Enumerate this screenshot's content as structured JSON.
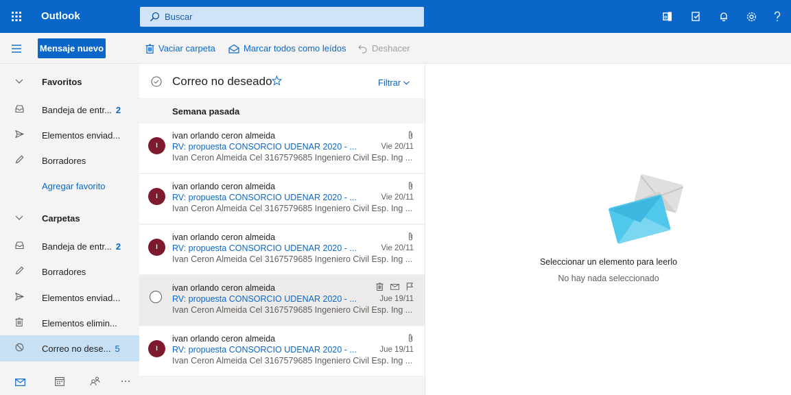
{
  "app": {
    "name": "Outlook",
    "search_placeholder": "Buscar"
  },
  "colors": {
    "brand": "#0a67c9",
    "avatar": "#7d1a2e",
    "selected_nav": "#c7e0f4"
  },
  "toolbar": {
    "new_message": "Mensaje nuevo",
    "empty_folder": "Vaciar carpeta",
    "mark_all_read": "Marcar todos como leídos",
    "undo": "Deshacer"
  },
  "nav": {
    "favorites_header": "Favoritos",
    "favorites": [
      {
        "label": "Bandeja de entr...",
        "count": "2",
        "icon": "inbox-icon"
      },
      {
        "label": "Elementos enviad...",
        "count": "",
        "icon": "send-icon"
      },
      {
        "label": "Borradores",
        "count": "",
        "icon": "pencil-icon"
      }
    ],
    "add_favorite": "Agregar favorito",
    "folders_header": "Carpetas",
    "folders": [
      {
        "label": "Bandeja de entr...",
        "count": "2",
        "icon": "inbox-icon"
      },
      {
        "label": "Borradores",
        "count": "",
        "icon": "pencil-icon"
      },
      {
        "label": "Elementos enviad...",
        "count": "",
        "icon": "send-icon"
      },
      {
        "label": "Elementos elimin...",
        "count": "",
        "icon": "trash-icon"
      },
      {
        "label": "Correo no dese...",
        "count": "5",
        "icon": "block-icon",
        "selected": true
      }
    ]
  },
  "list": {
    "title": "Correo no deseado",
    "filter": "Filtrar",
    "group": "Semana pasada",
    "messages": [
      {
        "initial": "I",
        "from": "ivan orlando ceron almeida",
        "subject": "RV: propuesta CONSORCIO UDENAR 2020 - ...",
        "preview": "Ivan Ceron Almeida Cel 3167579685 Ingeniero Civil Esp. Ing ...",
        "date": "Vie 20/11"
      },
      {
        "initial": "I",
        "from": "ivan orlando ceron almeida",
        "subject": "RV: propuesta CONSORCIO UDENAR 2020 - ...",
        "preview": "Ivan Ceron Almeida Cel 3167579685 Ingeniero Civil Esp. Ing ...",
        "date": "Vie 20/11"
      },
      {
        "initial": "I",
        "from": "ivan orlando ceron almeida",
        "subject": "RV: propuesta CONSORCIO UDENAR 2020 - ...",
        "preview": "Ivan Ceron Almeida Cel 3167579685 Ingeniero Civil Esp. Ing ...",
        "date": "Vie 20/11"
      },
      {
        "initial": "",
        "from": "ivan orlando ceron almeida",
        "subject": "RV: propuesta CONSORCIO UDENAR 2020 - ...",
        "preview": "Ivan Ceron Almeida Cel 3167579685 Ingeniero Civil Esp. Ing ...",
        "date": "Jue 19/11",
        "hovered": true
      },
      {
        "initial": "I",
        "from": "ivan orlando ceron almeida",
        "subject": "RV: propuesta CONSORCIO UDENAR 2020 - ...",
        "preview": "Ivan Ceron Almeida Cel 3167579685 Ingeniero Civil Esp. Ing ...",
        "date": "Jue 19/11"
      }
    ]
  },
  "reading": {
    "title": "Seleccionar un elemento para leerlo",
    "subtitle": "No hay nada seleccionado"
  }
}
